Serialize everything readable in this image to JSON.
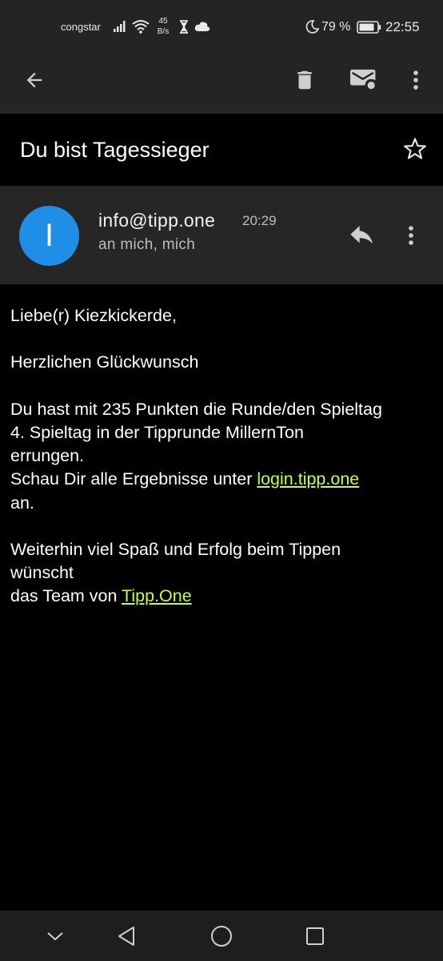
{
  "status": {
    "carrier": "congstar",
    "speed_value": "45",
    "speed_unit": "B/s",
    "battery_pct": "79 %",
    "time": "22:55"
  },
  "toolbar": {
    "icons": [
      "back-arrow-icon",
      "trash-icon",
      "mark-unread-icon",
      "more-vert-icon"
    ]
  },
  "email": {
    "subject": "Du bist Tagessieger",
    "sender_initial": "I",
    "sender": "info@tipp.one",
    "time": "20:29",
    "recipients": "an mich, mich",
    "avatar_color": "#1e8ee6"
  },
  "body": {
    "greeting": "Liebe(r) Kiezkickerde,",
    "congrats": "Herzlichen Glückwunsch",
    "line1": "Du hast mit 235 Punkten die Runde/den Spieltag",
    "line2": "4. Spieltag in der Tipprunde MillernTon",
    "line3": "errungen.",
    "line4_pre": "Schau Dir alle Ergebnisse unter ",
    "link1": "login.tipp.one",
    "line5": "an.",
    "line6": "Weiterhin viel Spaß und Erfolg beim Tippen",
    "line7": "wünscht",
    "line8_pre": "das Team von ",
    "link2": "Tipp.One",
    "link_color": "#c6ff3c"
  }
}
